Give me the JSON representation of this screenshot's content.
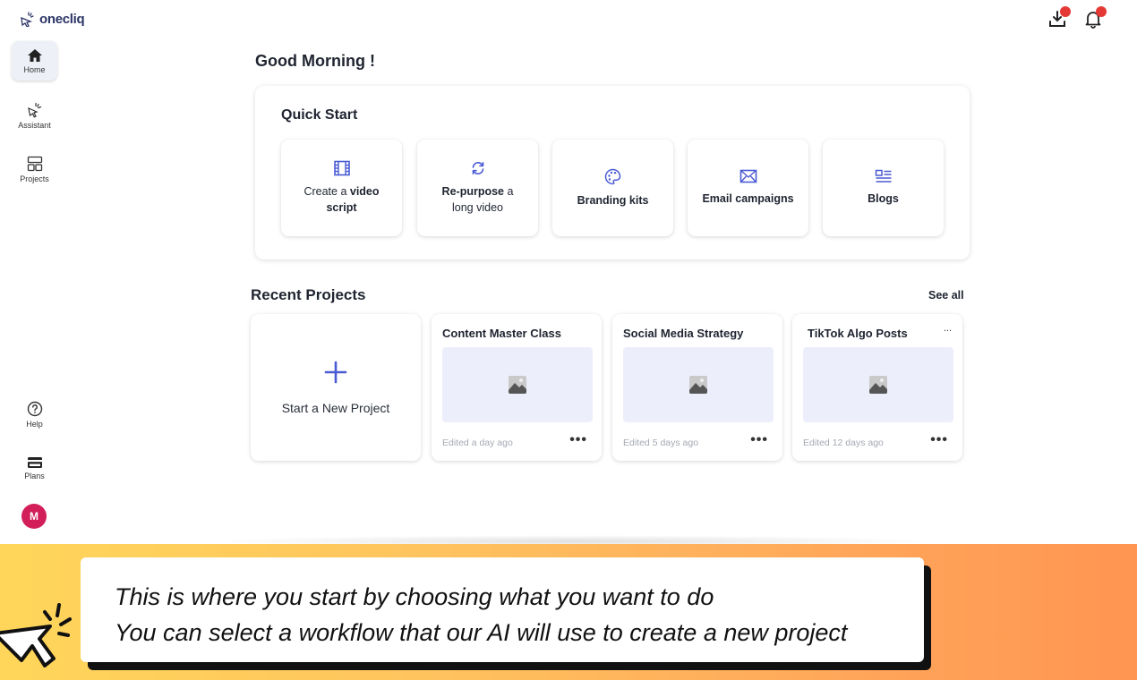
{
  "brand": {
    "name": "onecliq",
    "accent": "#4a5bd4",
    "logo_color": "#2c3566"
  },
  "topbar": {
    "icons": [
      {
        "name": "download-tray-icon",
        "badge": true
      },
      {
        "name": "bell-icon",
        "badge": true
      }
    ],
    "badge_color": "#e53935"
  },
  "sidebar": {
    "items": [
      {
        "label": "Home",
        "icon": "home-icon",
        "active": true
      },
      {
        "label": "Assistant",
        "icon": "sparkle-cursor-icon",
        "active": false
      },
      {
        "label": "Projects",
        "icon": "layout-icon",
        "active": false
      },
      {
        "label": "Help",
        "icon": "question-circle-icon",
        "active": false
      },
      {
        "label": "Plans",
        "icon": "credit-card-icon",
        "active": false
      }
    ],
    "avatar": {
      "initial": "M",
      "color": "#d21f5a"
    }
  },
  "main": {
    "greeting": "Good Morning !",
    "quick_start": {
      "title": "Quick Start",
      "cards": [
        {
          "icon": "film-icon",
          "pre": "Create a ",
          "bold": "video",
          "line2": "script"
        },
        {
          "icon": "refresh-icon",
          "bold": "Re-purpose",
          "pre_after": " a",
          "line2": "long video"
        },
        {
          "icon": "palette-icon",
          "bold": "Branding kits"
        },
        {
          "icon": "envelope-icon",
          "bold": "Email campaigns"
        },
        {
          "icon": "article-icon",
          "bold": "Blogs"
        }
      ]
    },
    "recent_projects": {
      "title": "Recent Projects",
      "see_all": "See all",
      "new_project_label": "Start a New Project",
      "projects": [
        {
          "name": "Content Master Class",
          "edited": "Edited a day ago",
          "more": "•••"
        },
        {
          "name": "Social Media Strategy",
          "edited": "Edited 5 days ago",
          "more": "•••"
        },
        {
          "name": "TikTok Algo Posts",
          "edited": "Edited 12 days ago",
          "more": "•••",
          "top_more": "..."
        }
      ]
    }
  },
  "caption": {
    "line1": "This is where you start by choosing what you want to do",
    "line2": "You can select a workflow that our AI will use to create a new project"
  }
}
